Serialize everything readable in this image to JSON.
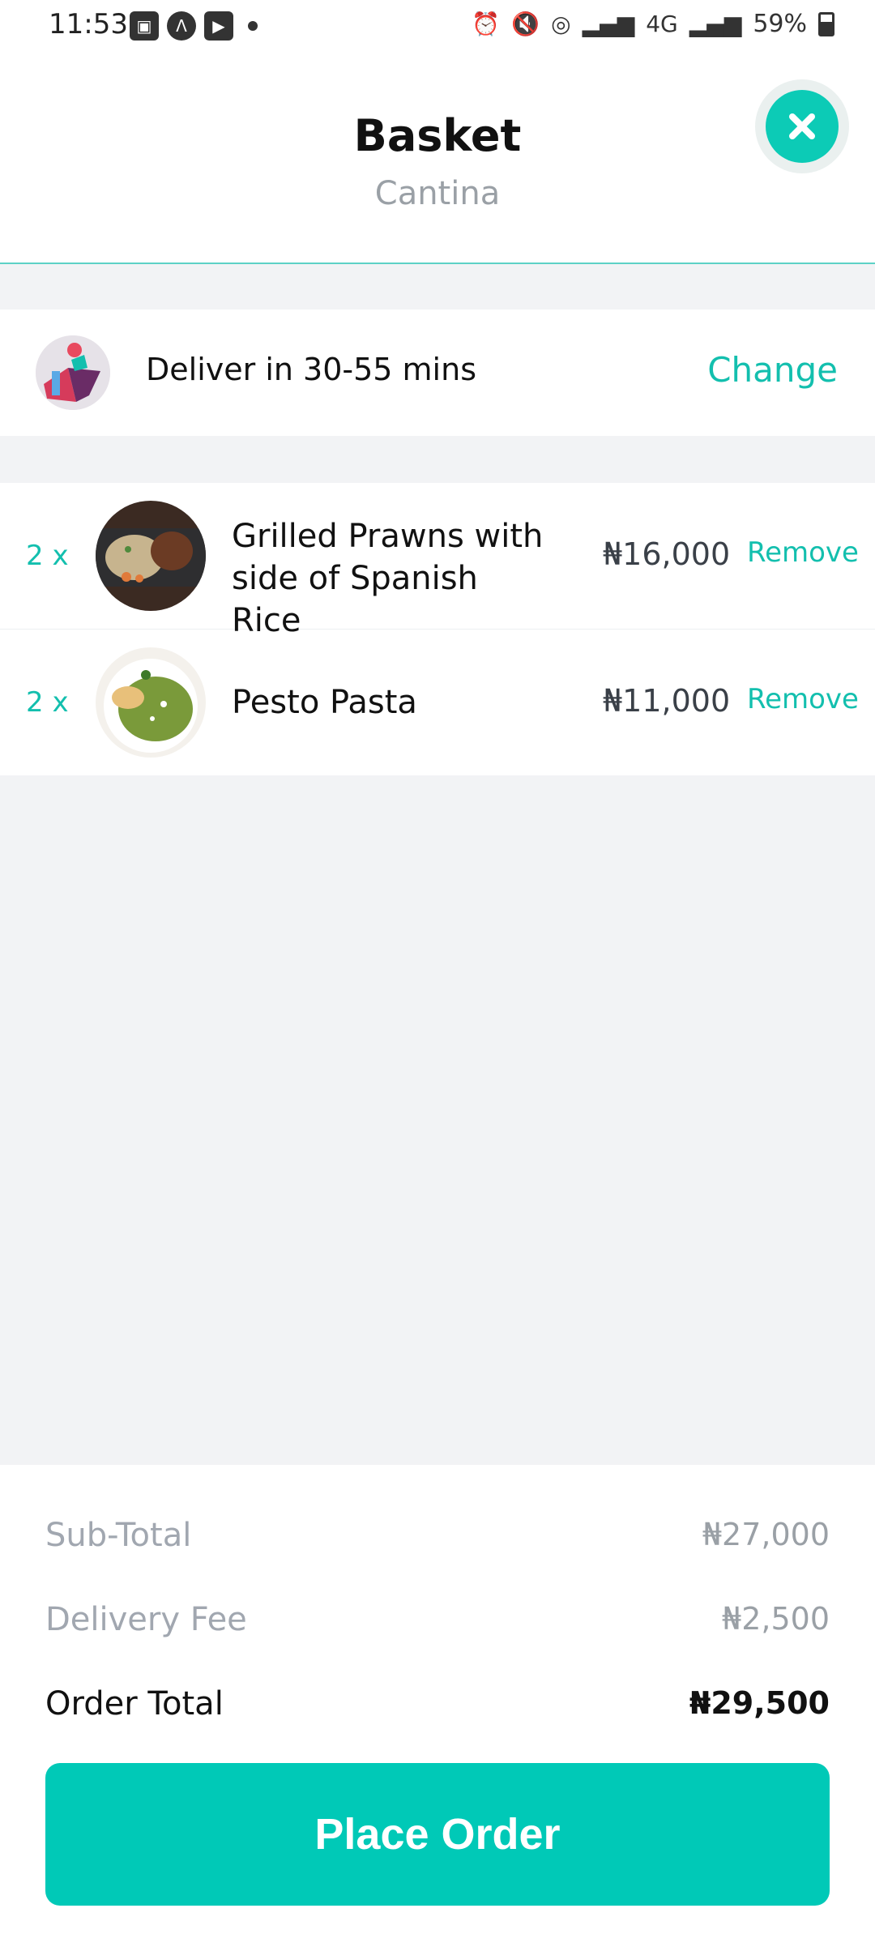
{
  "status_bar": {
    "time": "11:53",
    "battery": "59%",
    "battery_level": 0.59,
    "left_icons": [
      "image-icon",
      "a-icon",
      "youtube-icon",
      "dot-icon"
    ],
    "right_icons": [
      "alarm-icon",
      "mute-icon",
      "hotspot-icon",
      "signal-icon",
      "4g-icon",
      "signal-icon",
      "battery-icon"
    ],
    "network_label": "4G"
  },
  "header": {
    "title": "Basket",
    "subtitle": "Cantina"
  },
  "delivery": {
    "text": "Deliver in 30-55 mins",
    "change_label": "Change"
  },
  "items": [
    {
      "qty": "2 x",
      "name": "Grilled Prawns with side of Spanish Rice",
      "price": "₦16,000",
      "remove_label": "Remove"
    },
    {
      "qty": "2 x",
      "name": "Pesto Pasta",
      "price": "₦11,000",
      "remove_label": "Remove"
    }
  ],
  "summary": {
    "subtotal_label": "Sub-Total",
    "subtotal_value": "₦27,000",
    "delivery_fee_label": "Delivery Fee",
    "delivery_fee_value": "₦2,500",
    "order_total_label": "Order Total",
    "order_total_value": "₦29,500"
  },
  "cta": {
    "place_order_label": "Place Order"
  },
  "colors": {
    "accent": "#00c9b7",
    "background": "#f2f3f5",
    "text": "#111111",
    "muted": "#9aa0a6"
  }
}
